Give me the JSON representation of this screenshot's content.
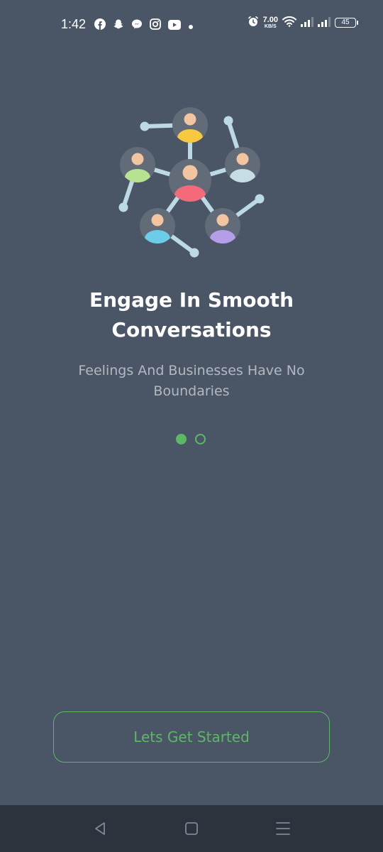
{
  "status_bar": {
    "time": "1:42",
    "left_icons": [
      "facebook-icon",
      "snapchat-icon",
      "messenger-icon",
      "instagram-icon",
      "youtube-icon",
      "more-dot-icon"
    ],
    "right_icons": [
      "alarm-icon",
      "wifi-icon",
      "signal-icon",
      "signal-icon"
    ],
    "net_speed_value": "7.00",
    "net_speed_unit": "KB/S",
    "battery_level": "45"
  },
  "onboarding": {
    "illustration_icon": "people-network-icon",
    "title": "Engage In Smooth Conversations",
    "subtitle": "Feelings And Businesses Have No Boundaries",
    "page_indicator": {
      "current": 1,
      "total": 2
    }
  },
  "cta": {
    "label": "Lets Get Started"
  },
  "nav_bar": {
    "icons": [
      "back-icon",
      "home-icon",
      "recents-icon"
    ]
  },
  "colors": {
    "background": "#4a5666",
    "accent": "#5cb865",
    "subtitle_text": "#b3b8bf",
    "nav_bar": "#2c333d"
  }
}
